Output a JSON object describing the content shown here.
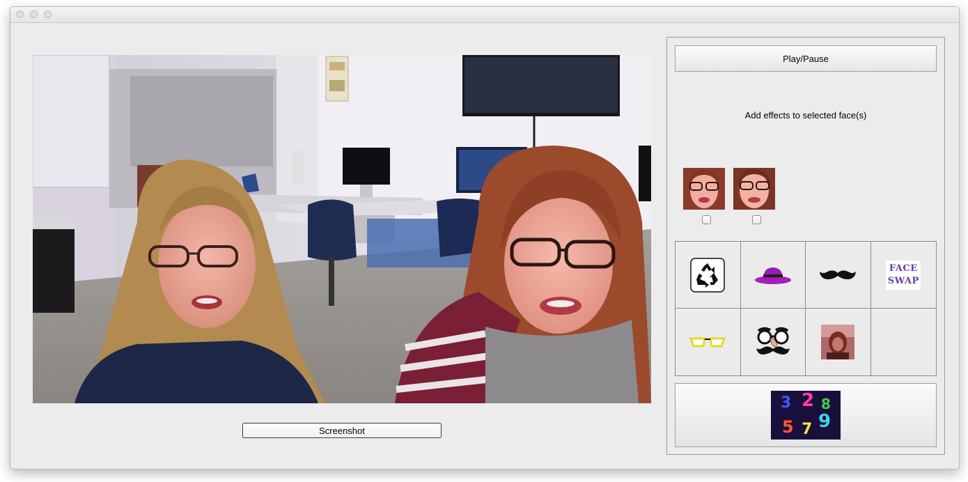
{
  "window": {
    "controls": [
      "close-icon",
      "minimize-icon",
      "zoom-icon"
    ]
  },
  "video": {
    "content": "webcam-frame-two-people"
  },
  "screenshot_button": {
    "label": "Screenshot"
  },
  "panel": {
    "play_pause_label": "Play/Pause",
    "effects_label": "Add effects to selected face(s)",
    "faces": [
      {
        "icon": "face-thumbnail-1",
        "checked": false
      },
      {
        "icon": "face-thumbnail-2",
        "checked": false
      }
    ],
    "effects": [
      {
        "icon": "recycle-icon"
      },
      {
        "icon": "hat-icon"
      },
      {
        "icon": "mustache-icon"
      },
      {
        "icon": "face-swap-icon",
        "words": [
          "FACE",
          "SWAP"
        ]
      },
      {
        "icon": "glasses-icon"
      },
      {
        "icon": "groucho-glasses-icon"
      },
      {
        "icon": "photo-thumbnail-icon"
      },
      {
        "icon": "empty-slot"
      }
    ],
    "bottom_button": {
      "icon": "numbers-game-icon",
      "glyphs": [
        "3",
        "2",
        "8",
        "5",
        "7",
        "9"
      ]
    }
  },
  "colors": {
    "window_bg": "#ececec",
    "hat": "#a51fbf",
    "glasses": "#e8d82a",
    "face_swap_text": "#6a3aa8"
  }
}
